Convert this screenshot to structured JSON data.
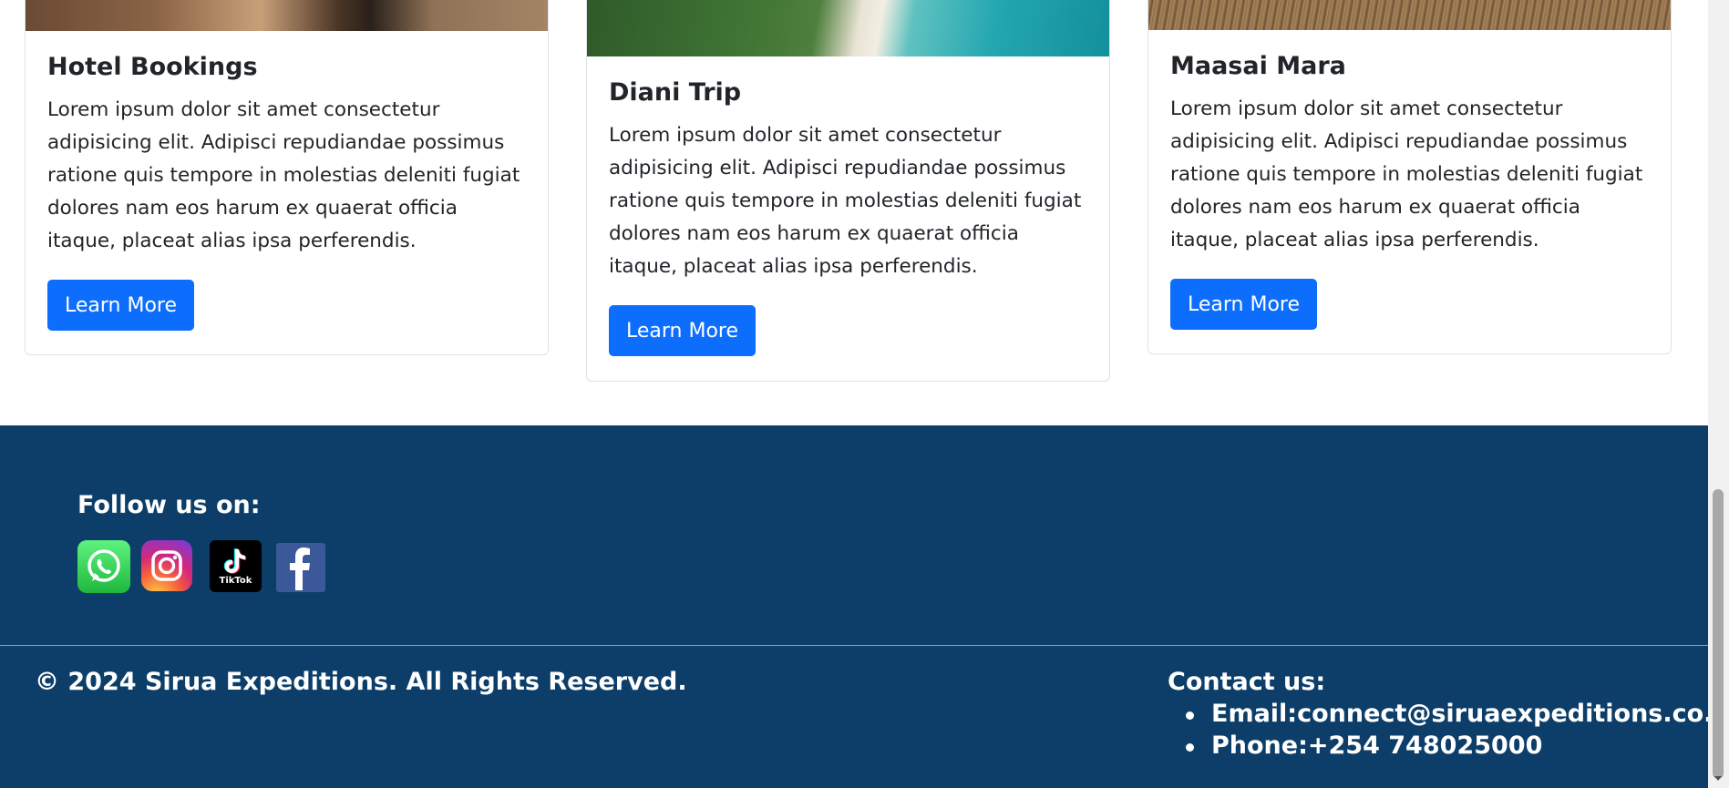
{
  "cards": [
    {
      "title": "Hotel Bookings",
      "text": "Lorem ipsum dolor sit amet consectetur adipisicing elit. Adipisci repudiandae possimus ratione quis tempore in molestias deleniti fugiat dolores nam eos harum ex quaerat officia itaque, placeat alias ipsa perferendis.",
      "button": "Learn More"
    },
    {
      "title": "Diani Trip",
      "text": "Lorem ipsum dolor sit amet consectetur adipisicing elit. Adipisci repudiandae possimus ratione quis tempore in molestias deleniti fugiat dolores nam eos harum ex quaerat officia itaque, placeat alias ipsa perferendis.",
      "button": "Learn More"
    },
    {
      "title": "Maasai Mara",
      "text": "Lorem ipsum dolor sit amet consectetur adipisicing elit. Adipisci repudiandae possimus ratione quis tempore in molestias deleniti fugiat dolores nam eos harum ex quaerat officia itaque, placeat alias ipsa perferendis.",
      "button": "Learn More"
    }
  ],
  "footer": {
    "follow_title": "Follow us on:",
    "social": [
      {
        "name": "whatsapp-icon"
      },
      {
        "name": "instagram-icon"
      },
      {
        "name": "tiktok-icon",
        "label": "TikTok"
      },
      {
        "name": "facebook-icon"
      }
    ],
    "copyright": "© 2024 Sirua Expeditions. All Rights Reserved.",
    "contact_title": "Contact us:",
    "email": "Email:connect@siruaexpeditions.co.ke",
    "phone": "Phone:+254 748025000"
  },
  "colors": {
    "footer_bg": "#0c3e69",
    "button_bg": "#0d6efd",
    "text": "#212529"
  }
}
